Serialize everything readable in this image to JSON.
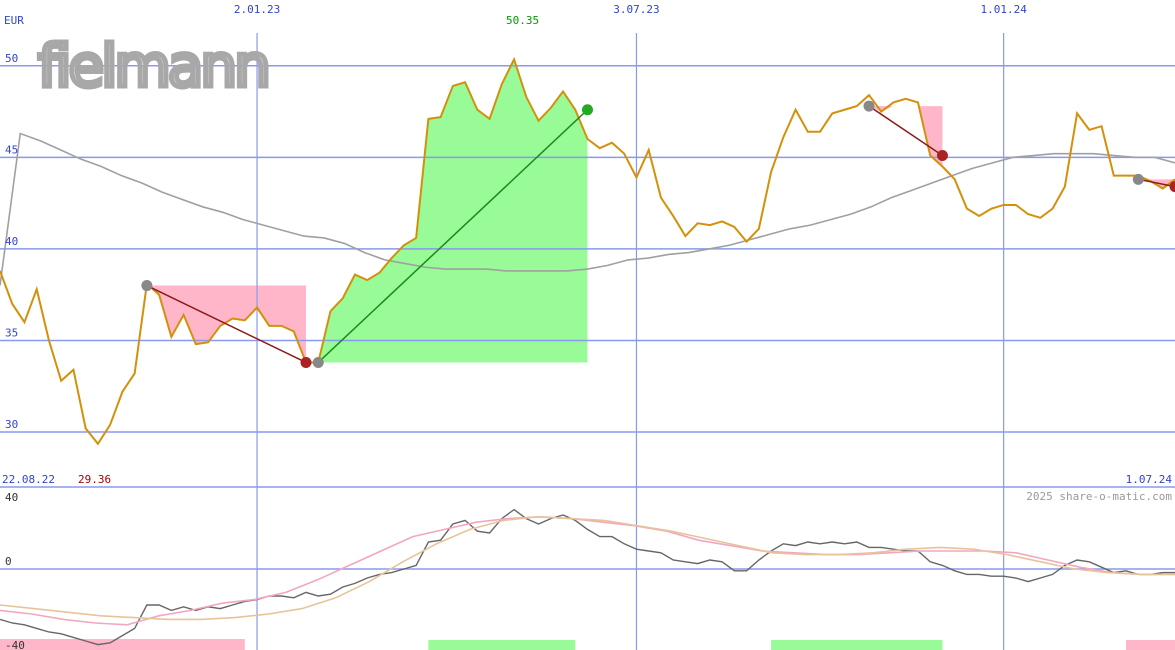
{
  "logo_text": "fielmann",
  "currency_label": "EUR",
  "watermark": "2025 share-o-matic.com",
  "date_start": "22.08.22",
  "date_end": "1.07.24",
  "min_label": "29.36",
  "max_label": "50.35",
  "colors": {
    "price": "#d4900a",
    "moving_average": "#a0a0a0",
    "gain_fill": "#98fb98",
    "loss_fill": "#ffb6c9",
    "grid": "#8899ee",
    "oscillator": "#666666",
    "signal_pink": "#f4a6c0",
    "signal_tan": "#e6c49a"
  },
  "chart_data": [
    {
      "type": "line",
      "panel": "price",
      "unit": "EUR",
      "x_ticks": [
        "2.01.23",
        "3.07.23",
        "1.01.24"
      ],
      "y_ticks": [
        30,
        35,
        40,
        45,
        50
      ],
      "ylim": [
        27.0,
        52.5
      ],
      "price": [
        38.8,
        37.0,
        36.0,
        37.8,
        35.0,
        32.8,
        33.4,
        30.2,
        29.36,
        30.4,
        32.2,
        33.2,
        38.1,
        37.5,
        35.2,
        36.4,
        34.8,
        34.9,
        35.8,
        36.2,
        36.1,
        36.8,
        35.8,
        35.8,
        35.5,
        33.8,
        33.8,
        36.6,
        37.3,
        38.6,
        38.3,
        38.7,
        39.5,
        40.2,
        40.6,
        47.1,
        47.2,
        48.9,
        49.1,
        47.6,
        47.1,
        49.0,
        50.35,
        48.3,
        47.0,
        47.7,
        48.6,
        47.6,
        46.0,
        45.5,
        45.8,
        45.2,
        43.9,
        45.4,
        42.8,
        41.8,
        40.7,
        41.4,
        41.3,
        41.5,
        41.2,
        40.4,
        41.1,
        44.2,
        46.1,
        47.6,
        46.4,
        46.4,
        47.4,
        47.6,
        47.8,
        48.4,
        47.5,
        48.0,
        48.2,
        48.0,
        45.1,
        44.5,
        43.8,
        42.2,
        41.8,
        42.2,
        42.4,
        42.4,
        41.9,
        41.7,
        42.2,
        43.4,
        47.4,
        46.5,
        46.7,
        44.0,
        44.0,
        44.0,
        43.7,
        43.3,
        43.8
      ],
      "moving_average": [
        38.0,
        46.3,
        45.9,
        45.4,
        44.9,
        44.5,
        44.0,
        43.6,
        43.1,
        42.7,
        42.3,
        42.0,
        41.6,
        41.3,
        41.0,
        40.7,
        40.6,
        40.3,
        39.8,
        39.4,
        39.2,
        39.0,
        38.9,
        38.9,
        38.9,
        38.8,
        38.8,
        38.8,
        38.8,
        38.9,
        39.1,
        39.4,
        39.5,
        39.7,
        39.8,
        40.0,
        40.2,
        40.5,
        40.8,
        41.1,
        41.3,
        41.6,
        41.9,
        42.3,
        42.8,
        43.2,
        43.6,
        44.0,
        44.4,
        44.7,
        45.0,
        45.1,
        45.2,
        45.2,
        45.2,
        45.1,
        45.0,
        45.0,
        44.7
      ],
      "trades": [
        {
          "entry": 38.0,
          "exit": 33.8,
          "result": "loss"
        },
        {
          "entry": 33.8,
          "exit": 47.6,
          "result": "gain"
        },
        {
          "entry": 47.8,
          "exit": 45.1,
          "result": "loss"
        },
        {
          "entry": 43.8,
          "exit": 43.4,
          "result": "loss"
        }
      ]
    },
    {
      "type": "line",
      "panel": "oscillator",
      "y_ticks": [
        -40,
        0,
        40
      ],
      "ylim": [
        -45,
        45
      ],
      "series": [
        {
          "values": [
            -28,
            -30,
            -31,
            -33,
            -35,
            -36,
            -38,
            -40,
            -42,
            -41,
            -37,
            -33,
            -20,
            -20,
            -23,
            -21,
            -23,
            -21,
            -22,
            -20,
            -18,
            -17,
            -15,
            -15,
            -16,
            -13,
            -15,
            -14,
            -10,
            -8,
            -5,
            -3,
            -2,
            0,
            2,
            15,
            16,
            25,
            27,
            21,
            20,
            28,
            33,
            28,
            25,
            28,
            30,
            27,
            22,
            18,
            18,
            14,
            11,
            10,
            9,
            5,
            4,
            3,
            5,
            4,
            -1,
            -1,
            5,
            10,
            14,
            13,
            15,
            14,
            15,
            14,
            15,
            12,
            12,
            11,
            10,
            10,
            4,
            2,
            -1,
            -3,
            -3,
            -4,
            -4,
            -5,
            -7,
            -5,
            -3,
            2,
            5,
            4,
            1,
            -2,
            -1,
            -3,
            -3,
            -2,
            -2
          ]
        },
        {
          "values": [
            -23,
            -25,
            -28,
            -30,
            -31,
            -26,
            -23,
            -19,
            -17,
            -13,
            -6,
            2,
            10,
            18,
            22,
            26,
            28,
            29,
            28,
            26,
            24,
            21,
            16,
            13,
            10,
            9,
            8,
            8,
            9,
            10,
            10,
            10,
            9,
            5,
            1,
            -2,
            -3,
            -3
          ]
        },
        {
          "values": [
            -20,
            -22,
            -24,
            -26,
            -27,
            -28,
            -28,
            -27,
            -25,
            -22,
            -16,
            -7,
            4,
            14,
            22,
            27,
            29,
            28,
            27,
            24,
            21,
            17,
            13,
            9,
            8,
            8,
            9,
            11,
            12,
            11,
            8,
            4,
            0,
            -2,
            -3,
            -3
          ]
        }
      ],
      "bars": [
        {
          "start": 0,
          "end": 20,
          "height": 0.5,
          "color": "pink"
        },
        {
          "start": 35,
          "end": 47,
          "height": 0.4,
          "color": "green"
        },
        {
          "start": 63,
          "end": 77,
          "height": 0.4,
          "color": "green"
        },
        {
          "start": 92,
          "end": 96,
          "height": 0.4,
          "color": "pink"
        }
      ]
    }
  ]
}
